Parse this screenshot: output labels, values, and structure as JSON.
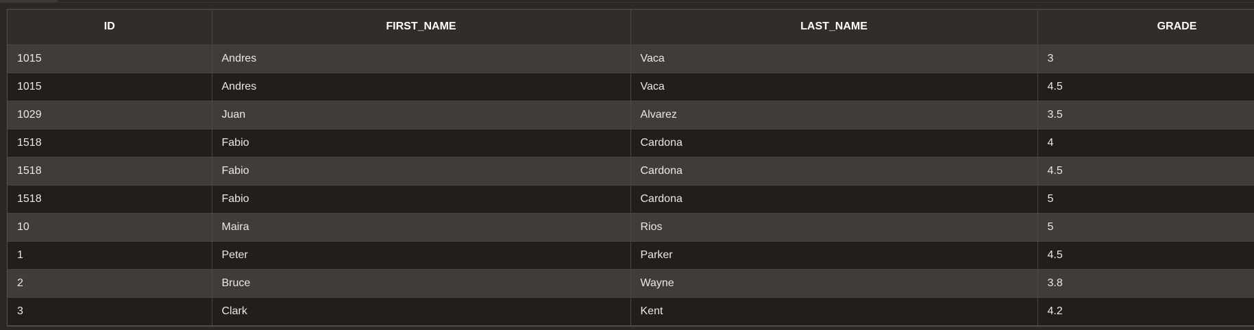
{
  "table": {
    "columns": [
      "ID",
      "FIRST_NAME",
      "LAST_NAME",
      "GRADE"
    ],
    "rows": [
      [
        "1015",
        "Andres",
        "Vaca",
        "3"
      ],
      [
        "1015",
        "Andres",
        "Vaca",
        "4.5"
      ],
      [
        "1029",
        "Juan",
        "Alvarez",
        "3.5"
      ],
      [
        "1518",
        "Fabio",
        "Cardona",
        "4"
      ],
      [
        "1518",
        "Fabio",
        "Cardona",
        "4.5"
      ],
      [
        "1518",
        "Fabio",
        "Cardona",
        "5"
      ],
      [
        "10",
        "Maira",
        "Rios",
        "5"
      ],
      [
        "1",
        "Peter",
        "Parker",
        "4.5"
      ],
      [
        "2",
        "Bruce",
        "Wayne",
        "3.8"
      ],
      [
        "3",
        "Clark",
        "Kent",
        "4.2"
      ]
    ]
  },
  "colors": {
    "background": "#2b2826",
    "header_bg": "#312d2a",
    "row_light": "#403c39",
    "row_dark": "#221e1c",
    "grid_line": "#4a4643"
  }
}
